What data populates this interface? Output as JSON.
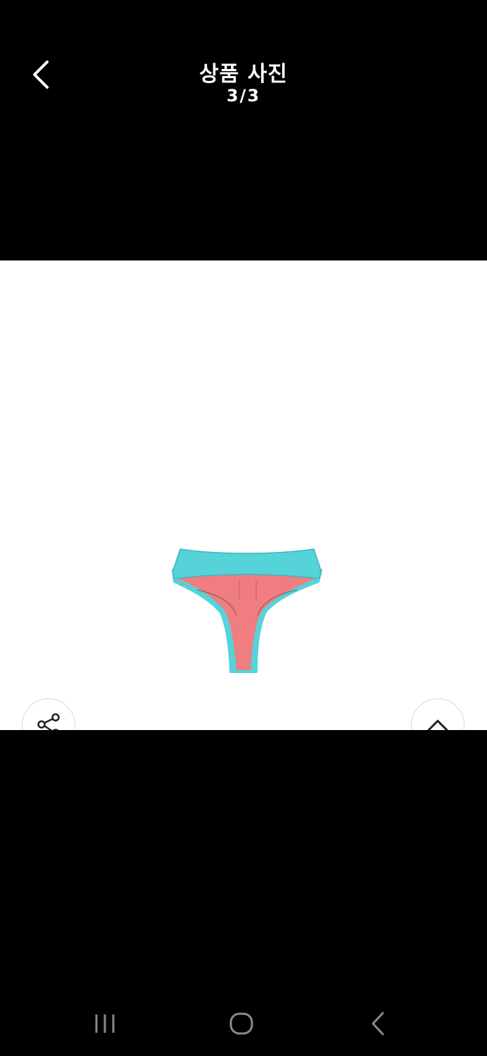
{
  "header": {
    "title": "상품 사진",
    "counter": "3/3",
    "back_icon": "chevron-left-icon"
  },
  "photo": {
    "current_index": 3,
    "total": 3,
    "colors": {
      "body": "#f07d80",
      "trim": "#55d3d9"
    }
  },
  "actions": {
    "share_icon": "share-icon",
    "scroll_top_icon": "chevron-up-icon"
  },
  "system_nav": {
    "recents_icon": "recents-icon",
    "home_icon": "home-icon",
    "back_icon": "back-icon"
  }
}
